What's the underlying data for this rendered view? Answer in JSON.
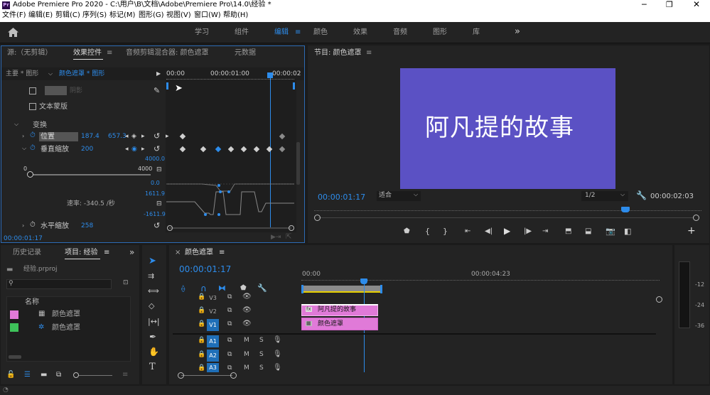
{
  "app": {
    "title": "Adobe Premiere Pro 2020 - C:\\用户\\B\\文档\\Adobe\\Premiere Pro\\14.0\\经验 *",
    "logo": "Pr"
  },
  "menu": [
    "文件(F)",
    "编辑(E)",
    "剪辑(C)",
    "序列(S)",
    "标记(M)",
    "图形(G)",
    "视图(V)",
    "窗口(W)",
    "帮助(H)"
  ],
  "workspaces": {
    "items": [
      "学习",
      "组件",
      "编辑",
      "颜色",
      "效果",
      "音频",
      "图形",
      "库"
    ],
    "active": "编辑",
    "more": "»"
  },
  "source_tabs": {
    "source": "源:（无剪辑）",
    "effects": "效果控件",
    "mixer": "音频剪辑混合器: 颜色遮罩",
    "meta": "元数据"
  },
  "effects": {
    "master": "主要 * 图形",
    "clip": "颜色遮罩 * 图形",
    "ruler": [
      "00:00",
      "00:00:01:00",
      "00:00:02"
    ],
    "shadow": "阴影",
    "textmask": "文本蒙版",
    "transform": "变换",
    "position": {
      "label": "位置",
      "x": "187.4",
      "y": "657.3"
    },
    "vscale": {
      "label": "垂直缩放",
      "value": "200",
      "max": "4000.0",
      "min": "0.0",
      "slider_min": "0",
      "slider_max": "4000"
    },
    "graph": {
      "top": "1611.9",
      "bottom": "-1611.9",
      "rate": "速率: -340.5 /秒"
    },
    "hscale": {
      "label": "水平缩放",
      "value": "258"
    },
    "timecode": "00:00:01:17"
  },
  "program": {
    "tab": "节目: 颜色遮罩",
    "title_text": "阿凡提的故事",
    "bg": "#5b51c4",
    "timecode": "00:00:01:17",
    "fit": "适合",
    "resolution": "1/2",
    "duration": "00:00:02:03"
  },
  "project": {
    "history": "历史记录",
    "project": "项目: 经验",
    "file": "经验.prproj",
    "col": "名称",
    "items": [
      {
        "name": "颜色遮罩",
        "color": "#e07ad8"
      },
      {
        "name": "颜色遮罩",
        "color": "#3ec35a"
      }
    ]
  },
  "timeline": {
    "tab": "颜色遮罩",
    "timecode": "00:00:01:17",
    "ruler": [
      "00:00",
      "00:00:04:23"
    ],
    "tracks": {
      "video": [
        "V3",
        "V2",
        "V1"
      ],
      "audio": [
        "A1",
        "A2",
        "A3"
      ]
    },
    "clips": [
      {
        "name": "阿凡提的故事",
        "track": "V2"
      },
      {
        "name": "颜色遮罩",
        "track": "V1"
      }
    ],
    "meter": [
      "-12",
      "-24",
      "-36"
    ]
  },
  "colors": {
    "accent": "#2d8ceb",
    "clip": "#e07ad8"
  }
}
